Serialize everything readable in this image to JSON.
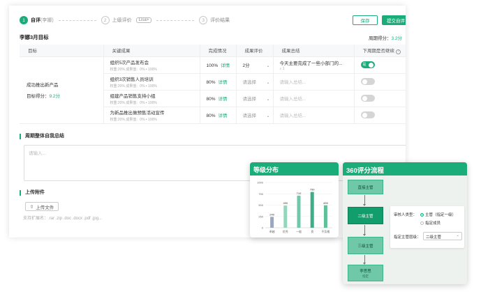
{
  "steps": [
    {
      "num": "1",
      "label": "自评",
      "sub": "(李娜)"
    },
    {
      "num": "2",
      "label": "上级评价",
      "tag": "Lisa>"
    },
    {
      "num": "3",
      "label": "评价结果"
    }
  ],
  "actions": {
    "save": "保存",
    "submit": "提交自评"
  },
  "title": "李娜3月目标",
  "period_score": {
    "label": "周期得分：",
    "value": "3.2分"
  },
  "table": {
    "headers": [
      "目标",
      "关键成果",
      "完成情况",
      "成果评价",
      "成果总结",
      "下周期是否继续"
    ],
    "goal": {
      "name": "成功推出新产品",
      "score_label": "目标得分：",
      "score_value": "9.2分"
    },
    "rows": [
      {
        "name": "组织5次产品发布会",
        "meta": "权重:20%   成果值：0% • 100%",
        "pct": "100%",
        "detail": "详情",
        "rating": "2分",
        "rating_set": true,
        "summary": "今天主要完成了一些小部门的...",
        "summary_set": true,
        "attach": "1",
        "toggle_on": true,
        "toggle_text": "是"
      },
      {
        "name": "组织3次销售人员培训",
        "meta": "权重:20%   成果值：0% • 100%",
        "pct": "80%",
        "detail": "详情",
        "rating": "请选择",
        "rating_set": false,
        "summary": "请输入总结...",
        "summary_set": false,
        "toggle_on": false,
        "toggle_text": "否"
      },
      {
        "name": "组建产品销售支持小组",
        "meta": "权重:20%   成果值：0% • 100%",
        "pct": "80%",
        "detail": "详情",
        "rating": "请选择",
        "rating_set": false,
        "summary": "请输入总结...",
        "summary_set": false,
        "toggle_on": false,
        "toggle_text": "否"
      },
      {
        "name": "为新品推出做预售活动宣传",
        "meta": "权重:20%   成果值：0% • 100%",
        "pct": "80%",
        "detail": "详情",
        "rating": "请选择",
        "rating_set": false,
        "summary": "请输入总结...",
        "summary_set": false,
        "toggle_on": false,
        "toggle_text": "否"
      }
    ]
  },
  "summary_section": {
    "title": "周期整体自我总结",
    "placeholder": "请输入..."
  },
  "attach_section": {
    "title": "上传附件",
    "button": "上传文件",
    "hint": "支持扩展名：.rar .zip .doc .docx .pdf .jpg..."
  },
  "grade_panel": {
    "title": "等级分布"
  },
  "chart_data": {
    "type": "bar",
    "categories": [
      "卓越",
      "优秀",
      "一般",
      "良",
      "不及格"
    ],
    "values": [
      240,
      490,
      710,
      790,
      495
    ],
    "ylim": [
      0,
      1000
    ],
    "yticks": [
      0,
      250,
      500,
      750,
      1000
    ],
    "grid": true,
    "colors": [
      "#9aa7c2",
      "#93d6bc",
      "#6fc8a8",
      "#3dae86",
      "#5ebf99"
    ]
  },
  "flow_panel": {
    "title": "360评分流程",
    "nodes": [
      {
        "label": "直接主管",
        "sub": ""
      },
      {
        "label": "二级主管",
        "sub": ""
      },
      {
        "label": "三级主管",
        "sub": ""
      },
      {
        "label": "李思思",
        "sub": "指定"
      }
    ],
    "approver_label": "审核人类型：",
    "option1": "主管（指定一级）",
    "option2": "指定成员",
    "level_label": "指定主管层级：",
    "level_value": "二级主管"
  },
  "colors": {
    "accent": "#1aad79"
  }
}
